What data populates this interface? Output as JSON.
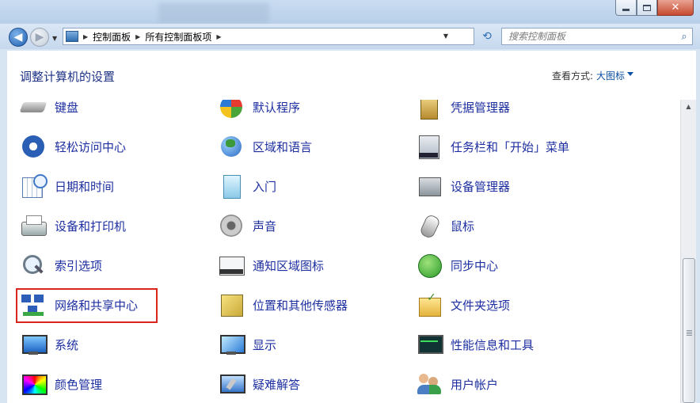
{
  "window": {
    "minimize_label": "",
    "maximize_label": "",
    "close_label": "✕"
  },
  "nav": {
    "back_glyph": "◀",
    "forward_glyph": "▶",
    "breadcrumb": [
      "控制面板",
      "所有控制面板项"
    ],
    "refresh_glyph": "⟲",
    "search_placeholder": "搜索控制面板",
    "search_glyph": "⌕"
  },
  "header": {
    "title": "调整计算机的设置",
    "view_by_label": "查看方式:",
    "view_by_value": "大图标"
  },
  "items": [
    {
      "label": "键盘",
      "icon": "keyboard-icon"
    },
    {
      "label": "默认程序",
      "icon": "default-programs-icon"
    },
    {
      "label": "凭据管理器",
      "icon": "credential-manager-icon"
    },
    {
      "label": "轻松访问中心",
      "icon": "ease-of-access-icon"
    },
    {
      "label": "区域和语言",
      "icon": "region-language-icon"
    },
    {
      "label": "任务栏和「开始」菜单",
      "icon": "taskbar-start-menu-icon"
    },
    {
      "label": "日期和时间",
      "icon": "date-time-icon"
    },
    {
      "label": "入门",
      "icon": "getting-started-icon"
    },
    {
      "label": "设备管理器",
      "icon": "device-manager-icon"
    },
    {
      "label": "设备和打印机",
      "icon": "devices-printers-icon"
    },
    {
      "label": "声音",
      "icon": "sound-icon"
    },
    {
      "label": "鼠标",
      "icon": "mouse-icon"
    },
    {
      "label": "索引选项",
      "icon": "indexing-options-icon"
    },
    {
      "label": "通知区域图标",
      "icon": "notification-area-icon"
    },
    {
      "label": "同步中心",
      "icon": "sync-center-icon"
    },
    {
      "label": "网络和共享中心",
      "icon": "network-sharing-icon",
      "highlighted": true
    },
    {
      "label": "位置和其他传感器",
      "icon": "location-sensors-icon"
    },
    {
      "label": "文件夹选项",
      "icon": "folder-options-icon"
    },
    {
      "label": "系统",
      "icon": "system-icon"
    },
    {
      "label": "显示",
      "icon": "display-icon"
    },
    {
      "label": "性能信息和工具",
      "icon": "performance-icon"
    },
    {
      "label": "颜色管理",
      "icon": "color-management-icon"
    },
    {
      "label": "疑难解答",
      "icon": "troubleshooting-icon"
    },
    {
      "label": "用户帐户",
      "icon": "user-accounts-icon"
    }
  ],
  "colors": {
    "link": "#1d2fa0",
    "title": "#1e3287",
    "highlight_border": "#d9251c"
  }
}
